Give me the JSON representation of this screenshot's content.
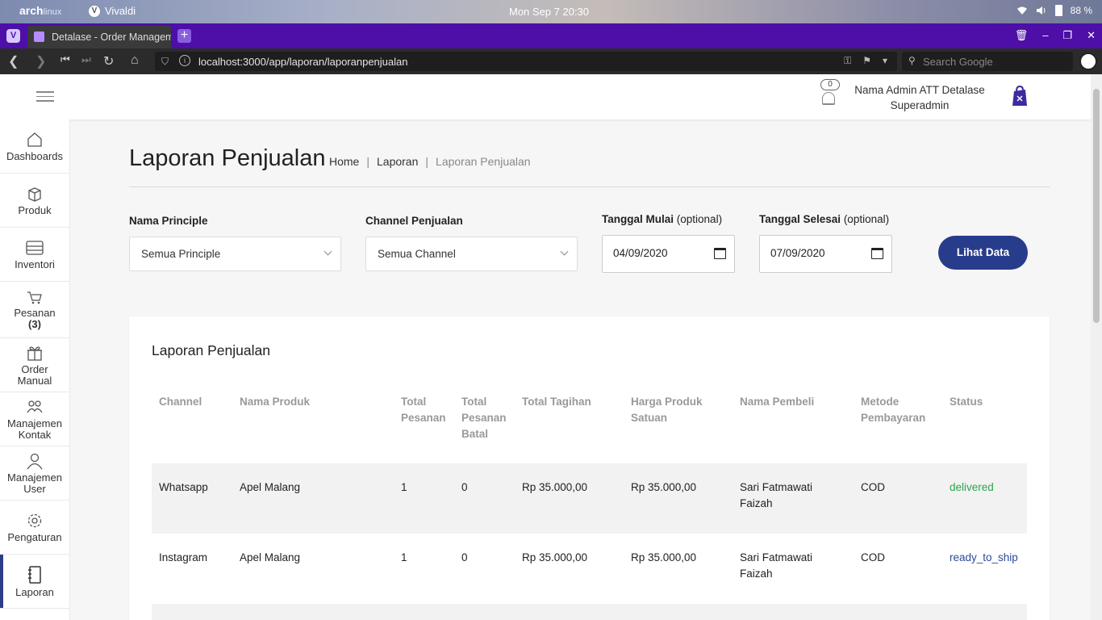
{
  "system": {
    "distro_logo": "arch",
    "distro_logo_sub": "linux",
    "app_name": "Vivaldi",
    "clock": "Mon Sep 7  20:30",
    "battery": "88 %"
  },
  "browser": {
    "tab_title": "Detalase - Order Managem",
    "url": "localhost:3000/app/laporan/laporanpenjualan",
    "search_placeholder": "Search Google"
  },
  "header": {
    "notif_count": "0",
    "user_name": "Nama Admin ATT Detalase",
    "user_role": "Superadmin"
  },
  "sidebar": {
    "items": [
      {
        "label": "Dashboards",
        "icon": "home-icon"
      },
      {
        "label": "Produk",
        "icon": "box-icon"
      },
      {
        "label": "Inventori",
        "icon": "warehouse-icon"
      },
      {
        "label": "Pesanan",
        "count": "(3)",
        "icon": "cart-icon"
      },
      {
        "label": "Order",
        "label2": "Manual",
        "icon": "gift-icon"
      },
      {
        "label": "Manajemen",
        "label2": "Kontak",
        "icon": "contacts-icon"
      },
      {
        "label": "Manajemen",
        "label2": "User",
        "icon": "user-icon"
      },
      {
        "label": "Pengaturan",
        "icon": "gear-icon"
      },
      {
        "label": "Laporan",
        "icon": "notebook-icon"
      }
    ]
  },
  "page": {
    "title": "Laporan Penjualan",
    "breadcrumb": [
      "Home",
      "Laporan",
      "Laporan Penjualan"
    ]
  },
  "filters": {
    "principle_label": "Nama Principle",
    "principle_value": "Semua Principle",
    "channel_label": "Channel Penjualan",
    "channel_value": "Semua Channel",
    "start_label": "Tanggal Mulai",
    "start_optional": "(optional)",
    "start_value": "04/09/2020",
    "end_label": "Tanggal Selesai",
    "end_optional": "(optional)",
    "end_value": "07/09/2020",
    "submit_label": "Lihat Data"
  },
  "report": {
    "title": "Laporan Penjualan",
    "columns": [
      [
        "Channel"
      ],
      [
        "Nama Produk"
      ],
      [
        "Total",
        "Pesanan"
      ],
      [
        "Total",
        "Pesanan",
        "Batal"
      ],
      [
        "Total Tagihan"
      ],
      [
        "Harga Produk",
        "Satuan"
      ],
      [
        "Nama Pembeli"
      ],
      [
        "Metode",
        "Pembayaran"
      ],
      [
        "Status"
      ]
    ],
    "rows": [
      {
        "channel": "Whatsapp",
        "product": "Apel Malang",
        "total": "1",
        "cancelled": "0",
        "bill": "Rp 35.000,00",
        "unit_price": "Rp 35.000,00",
        "buyer1": "Sari Fatmawati",
        "buyer2": "Faizah",
        "payment": "COD",
        "status": "delivered"
      },
      {
        "channel": "Instagram",
        "product": "Apel Malang",
        "total": "1",
        "cancelled": "0",
        "bill": "Rp 35.000,00",
        "unit_price": "Rp 35.000,00",
        "buyer1": "Sari Fatmawati",
        "buyer2": "Faizah",
        "payment": "COD",
        "status": "ready_to_ship"
      }
    ]
  },
  "colors": {
    "accent": "#283c8c",
    "tabbar": "#4d0fa8",
    "status_delivered": "#2aa64a",
    "status_ready": "#2c4a9a"
  }
}
